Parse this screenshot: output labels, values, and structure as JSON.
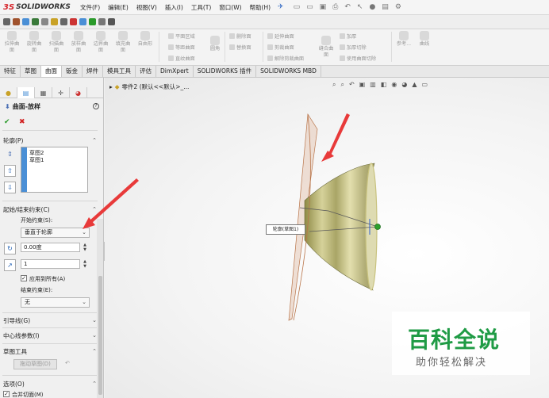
{
  "app": {
    "logo_prefix": "3S",
    "logo_name": "SOLIDWORKS"
  },
  "menubar": {
    "items": [
      "文件(F)",
      "编辑(E)",
      "视图(V)",
      "插入(I)",
      "工具(T)",
      "窗口(W)",
      "帮助(H)"
    ],
    "pin_icon": "pin-icon"
  },
  "ribbon": {
    "big": [
      "拉伸曲面",
      "旋转曲面",
      "扫描曲面",
      "放样曲面",
      "边界曲面",
      "填充曲面",
      "自由形"
    ],
    "group1": [
      "平面区域",
      "等距曲面",
      "直纹曲面"
    ],
    "fillet": "圆角",
    "group2": [
      "删除面",
      "替换面"
    ],
    "group3": [
      "延伸曲面",
      "剪裁曲面",
      "解除剪裁曲面"
    ],
    "knit": "缝合曲面",
    "group4": [
      "加厚",
      "加厚切除",
      "使用曲面切除"
    ],
    "ref": "参考...",
    "curve": "曲线"
  },
  "tabs": [
    "特征",
    "草图",
    "曲面",
    "钣金",
    "焊件",
    "模具工具",
    "评估",
    "DimXpert",
    "SOLIDWORKS 插件",
    "SOLIDWORKS MBD"
  ],
  "active_tab": "曲面",
  "panel": {
    "title": "曲面-放样",
    "ok": "✔",
    "cancel": "✖",
    "help": "?",
    "sections": {
      "profiles": {
        "label": "轮廓(P)",
        "items": [
          "草图2",
          "草图1"
        ]
      },
      "constraints": {
        "label": "起始/结束约束(C)",
        "start_label": "开始约束(S):",
        "start_value": "垂直于轮廓",
        "angle_value": "0.00度",
        "length_value": "1",
        "apply_all_label": "应用到所有(A)",
        "apply_all_checked": true,
        "end_label": "结束约束(E):",
        "end_value": "无"
      },
      "guides": {
        "label": "引导线(G)"
      },
      "centerline": {
        "label": "中心线参数(I)"
      },
      "sketch_tools": {
        "label": "草图工具",
        "drag_label": "拖动草图(D)"
      },
      "options": {
        "label": "选项(O)",
        "merge_label": "合并切面(M)",
        "merge_checked": true
      }
    }
  },
  "viewport": {
    "tree_item": "零件2 (默认<<默认>_...",
    "callout": "轮廓(草图1)"
  },
  "watermark": {
    "title": "百科全说",
    "subtitle": "助你轻松解决"
  },
  "colors": {
    "accent": "#d6262c",
    "blue": "#4a8fd6",
    "ok_green": "#2a9a2a",
    "cone": "#cfcf9a",
    "watermark_green": "#1f9b45"
  }
}
